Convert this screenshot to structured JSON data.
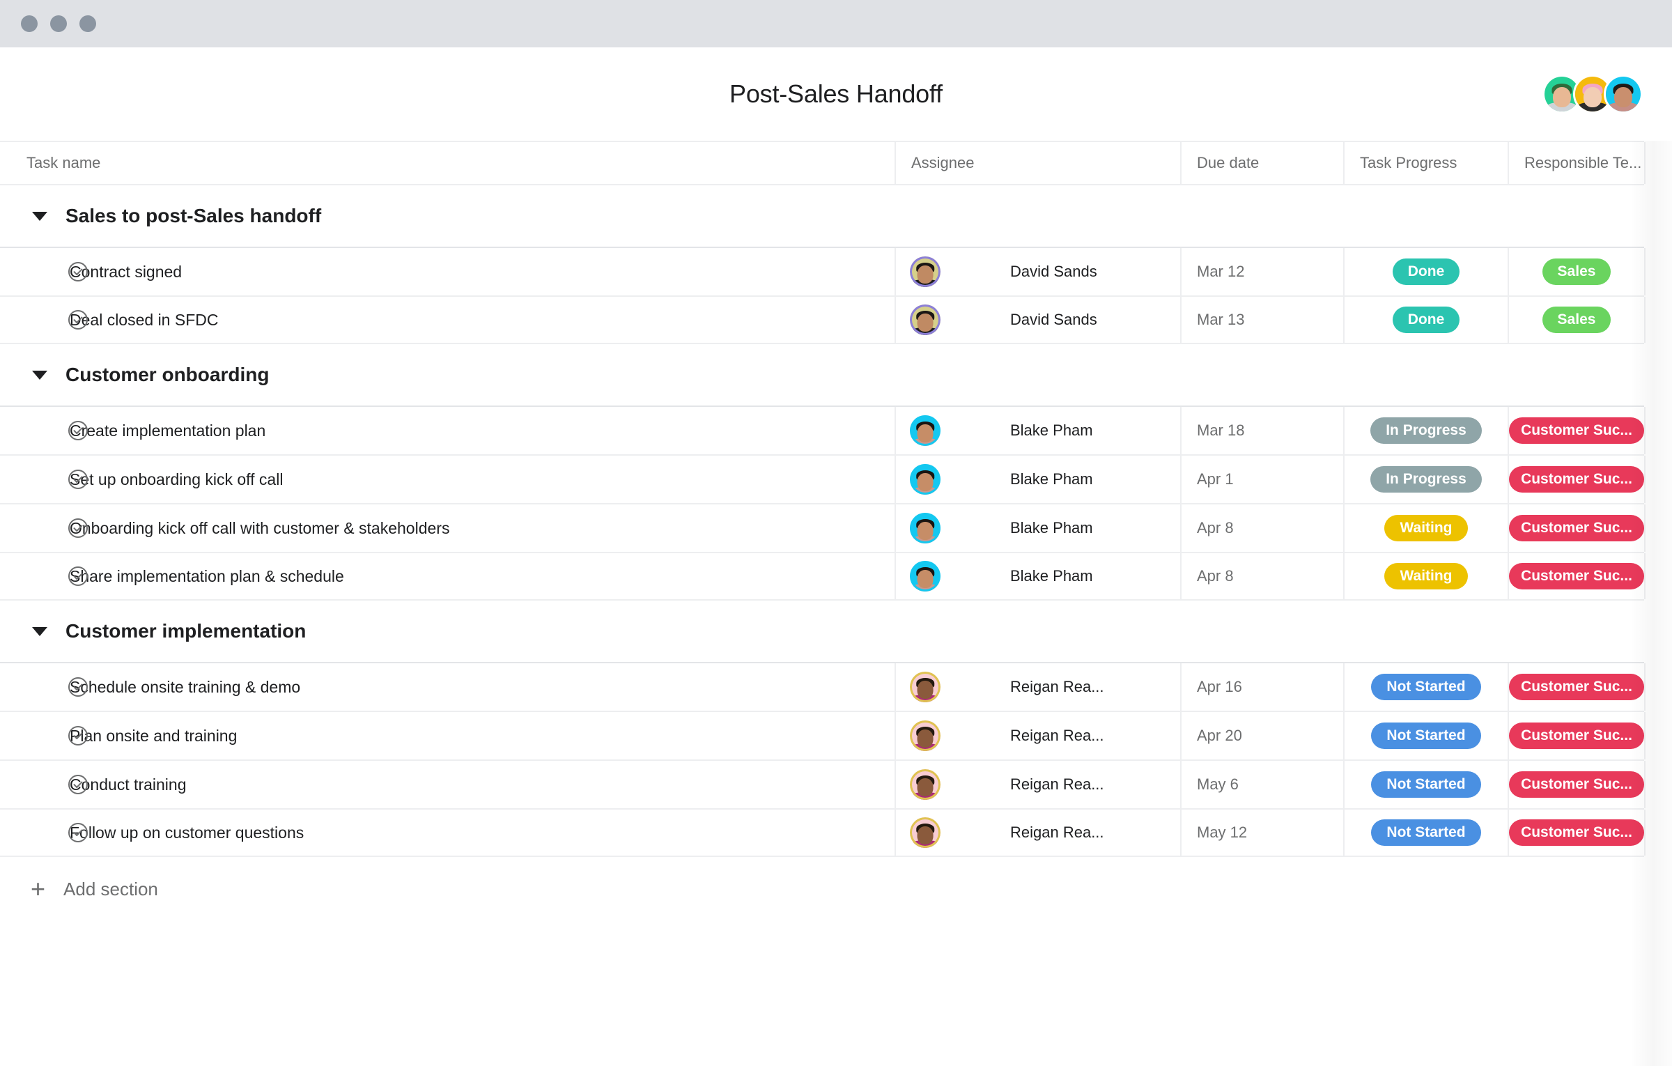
{
  "window": {
    "chrome_color": "#dfe1e5",
    "dot_color": "#8b95a1",
    "dots": [
      "close-dot",
      "minimize-dot",
      "maximize-dot"
    ]
  },
  "header": {
    "title": "Post-Sales Handoff",
    "members": [
      {
        "name": "member-1",
        "bg": "#25d196",
        "hair": "#2f6b3a",
        "skin": "#e8b894",
        "shirt": "#cfd4d8"
      },
      {
        "name": "member-2",
        "bg": "#f5ba0d",
        "hair": "#f3a6c4",
        "skin": "#f2cdb4",
        "shirt": "#2b2b2b"
      },
      {
        "name": "member-3",
        "bg": "#14c8f0",
        "hair": "#1f1a17",
        "skin": "#c98f6e",
        "shirt": "#c68e86"
      }
    ]
  },
  "table": {
    "columns": [
      {
        "key": "task_name",
        "label": "Task name"
      },
      {
        "key": "assignee",
        "label": "Assignee"
      },
      {
        "key": "due_date",
        "label": "Due date"
      },
      {
        "key": "task_progress",
        "label": "Task Progress"
      },
      {
        "key": "responsible_team",
        "label": "Responsible Te..."
      }
    ],
    "add_column_label": "+",
    "add_section_label": "Add section"
  },
  "people": {
    "david": {
      "name": "David Sands",
      "bg": "#d6d08a",
      "ring": "#8c7fd8",
      "hair": "#1b1715",
      "skin": "#c08a63",
      "shirt": "#1d1d1f"
    },
    "blake": {
      "name": "Blake Pham",
      "bg": "#14c8f0",
      "ring": "#14c8f0",
      "hair": "#1a1512",
      "skin": "#c68d67",
      "shirt": "#c99790"
    },
    "reigan": {
      "name": "Reigan Rea...",
      "bg": "#f8cdd3",
      "ring": "#e0c352",
      "hair": "#23190f",
      "skin": "#8a5a3c",
      "shirt": "#ad2a78"
    }
  },
  "badge_colors": {
    "Done": "#2bc4b0",
    "In Progress": "#8fa5a8",
    "Waiting": "#edc200",
    "Not Started": "#4a90e2",
    "Sales": "#6ad45f",
    "Customer Suc...": "#e8395a"
  },
  "sections": [
    {
      "title": "Sales to post-Sales handoff",
      "expanded": true,
      "tasks": [
        {
          "name": "Contract signed",
          "assignee": "David Sands",
          "assignee_key": "david",
          "due": "Mar 12",
          "progress": "Done",
          "team": "Sales"
        },
        {
          "name": "Deal closed in SFDC",
          "assignee": "David Sands",
          "assignee_key": "david",
          "due": "Mar 13",
          "progress": "Done",
          "team": "Sales"
        }
      ]
    },
    {
      "title": "Customer onboarding",
      "expanded": true,
      "tasks": [
        {
          "name": "Create implementation plan",
          "assignee": "Blake Pham",
          "assignee_key": "blake",
          "due": "Mar 18",
          "progress": "In Progress",
          "team": "Customer Suc..."
        },
        {
          "name": "Set up onboarding kick off call",
          "assignee": "Blake Pham",
          "assignee_key": "blake",
          "due": "Apr 1",
          "progress": "In Progress",
          "team": "Customer Suc..."
        },
        {
          "name": "Onboarding kick off call with customer & stakeholders",
          "assignee": "Blake Pham",
          "assignee_key": "blake",
          "due": "Apr 8",
          "progress": "Waiting",
          "team": "Customer Suc..."
        },
        {
          "name": "Share implementation plan & schedule",
          "assignee": "Blake Pham",
          "assignee_key": "blake",
          "due": "Apr 8",
          "progress": "Waiting",
          "team": "Customer Suc..."
        }
      ]
    },
    {
      "title": "Customer implementation",
      "expanded": true,
      "tasks": [
        {
          "name": "Schedule onsite training & demo",
          "assignee": "Reigan Rea...",
          "assignee_key": "reigan",
          "due": "Apr 16",
          "progress": "Not Started",
          "team": "Customer Suc..."
        },
        {
          "name": "Plan onsite and training",
          "assignee": "Reigan Rea...",
          "assignee_key": "reigan",
          "due": "Apr 20",
          "progress": "Not Started",
          "team": "Customer Suc..."
        },
        {
          "name": "Conduct training",
          "assignee": "Reigan Rea...",
          "assignee_key": "reigan",
          "due": "May 6",
          "progress": "Not Started",
          "team": "Customer Suc..."
        },
        {
          "name": "Follow up on customer questions",
          "assignee": "Reigan Rea...",
          "assignee_key": "reigan",
          "due": "May 12",
          "progress": "Not Started",
          "team": "Customer Suc..."
        }
      ]
    }
  ]
}
